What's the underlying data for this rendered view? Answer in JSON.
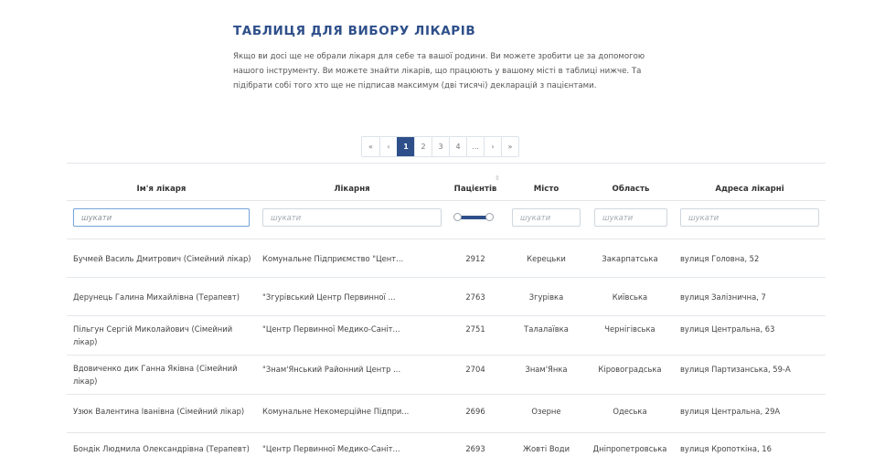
{
  "header": {
    "title": "ТАБЛИЦЯ ДЛЯ ВИБОРУ ЛІКАРІВ",
    "intro": "Якщо ви досі ще не обрали лікаря для себе та вашої родини. Ви можете зробити це за допомогою нашого інструменту. Ви можете знайти лікарів, що працюють у вашому місті в таблиці нижче. Та підібрати собі того хто ще не підписав максимум (дві тисячі) декларацій з пацієнтами."
  },
  "pagination": {
    "first": "«",
    "prev": "‹",
    "pages": [
      "1",
      "2",
      "3",
      "4"
    ],
    "ellipsis": "...",
    "next": "›",
    "last": "»",
    "current": "1"
  },
  "table": {
    "columns": {
      "name": "Ім'я лікаря",
      "hospital": "Лікарня",
      "patients": "Пацієнтів",
      "city": "Місто",
      "region": "Область",
      "address": "Адреса лікарні"
    },
    "sort_icon": "⇳",
    "filter_placeholder": "шукати",
    "rows": [
      {
        "name": "Бучмей Василь Дмитрович (Сімейний лікар)",
        "hospital": "Комунальне Підприємство \"Цент...",
        "patients": "2912",
        "city": "Керецьки",
        "region": "Закарпатська",
        "address": "вулиця Головна, 52"
      },
      {
        "name": "Дерунець Галина Михайлівна (Терапевт)",
        "hospital": "\"Згурівський Центр Первинної ...",
        "patients": "2763",
        "city": "Згурівка",
        "region": "Київська",
        "address": "вулиця Залізнична, 7"
      },
      {
        "name": "Пільгун Сергій Миколайович (Сімейний лікар)",
        "hospital": "\"Центр Первинної Медико-Саніт...",
        "patients": "2751",
        "city": "Талалаївка",
        "region": "Чернігівська",
        "address": "вулиця Центральна, 63"
      },
      {
        "name": "Вдовиченко дик Ганна Яківна (Сімейний лікар)",
        "hospital": "\"Знам'Янський Районний Центр ...",
        "patients": "2704",
        "city": "Знам'Янка",
        "region": "Кіровоградська",
        "address": "вулиця Партизанська, 59-А"
      },
      {
        "name": "Узюк Валентина Іванівна (Сімейний лікар)",
        "hospital": "Комунальне Некомерційне Підпри...",
        "patients": "2696",
        "city": "Озерне",
        "region": "Одеська",
        "address": "вулиця Центральна, 29А"
      },
      {
        "name": "Бондік Людмила Олександрівна (Терапевт)",
        "hospital": "\"Центр Первинної Медико-Саніт...",
        "patients": "2693",
        "city": "Жовті Води",
        "region": "Дніпропетровська",
        "address": "вулиця Кропоткіна, 16"
      }
    ]
  },
  "colors": {
    "accent": "#2e4f8a",
    "border": "#e3e6ea"
  }
}
